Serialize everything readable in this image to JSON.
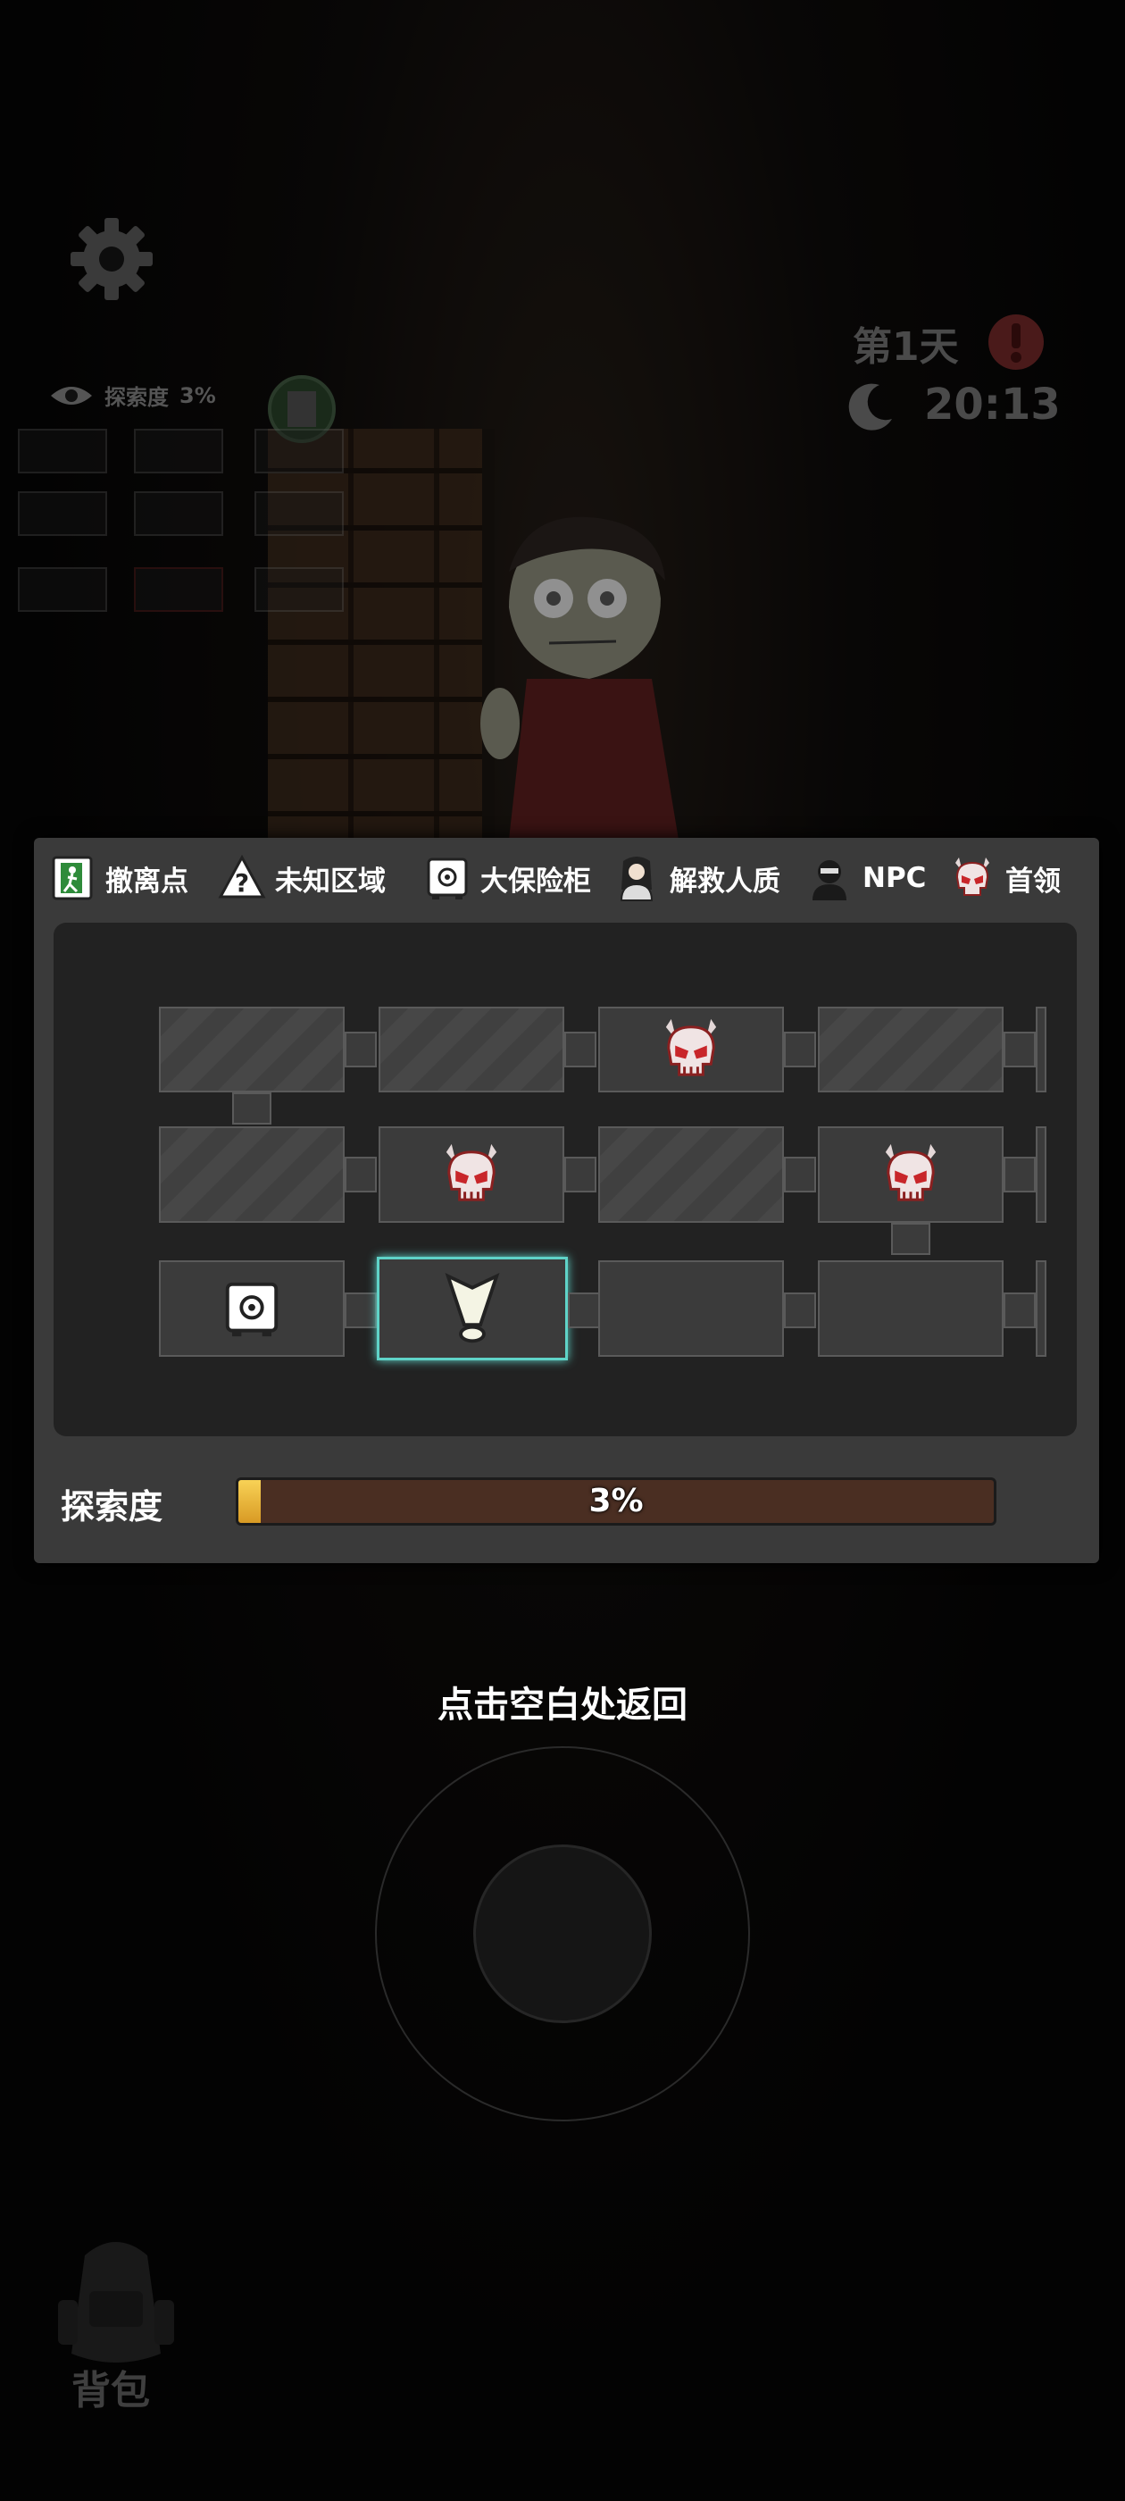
{
  "hud": {
    "explore_mini_label": "探索度",
    "explore_mini_value": "3%",
    "day": "第1天",
    "time": "20:13"
  },
  "legend": [
    {
      "icon": "exit-icon",
      "label": "撤离点"
    },
    {
      "icon": "unknown-area-icon",
      "label": "未知区域"
    },
    {
      "icon": "safe-icon",
      "label": "大保险柜"
    },
    {
      "icon": "hostage-icon",
      "label": "解救人质"
    },
    {
      "icon": "npc-icon",
      "label": "NPC"
    },
    {
      "icon": "boss-skull-icon",
      "label": "首领"
    }
  ],
  "map": {
    "rows": [
      [
        "unknown",
        "unknown",
        "boss",
        "unknown"
      ],
      [
        "unknown",
        "boss",
        "unknown",
        "boss"
      ],
      [
        "safe",
        "current",
        "empty",
        "empty"
      ]
    ]
  },
  "exploration": {
    "label": "探索度",
    "percent": 3,
    "text": "3%"
  },
  "hint": "点击空白处返回",
  "backpack": {
    "label": "背包"
  },
  "colors": {
    "panel": "#3a3a3a",
    "map_bg": "#222222",
    "current_room_border": "#5fd3c8",
    "progress_fill": "#f0c040",
    "progress_track": "#4a2e22",
    "boss_red": "#c8262a"
  }
}
